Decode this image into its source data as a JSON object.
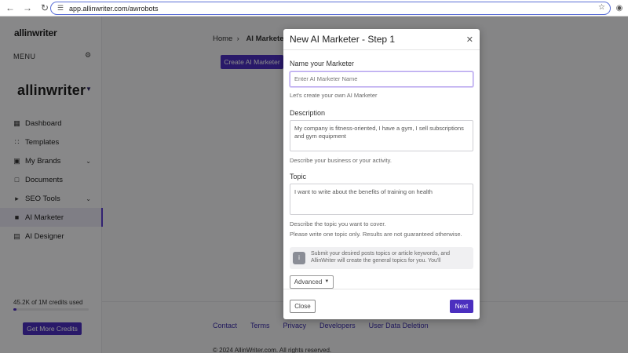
{
  "browser": {
    "url": "app.allinwriter.com/awrobots"
  },
  "sidebar": {
    "logo_small": "allinwriter",
    "menu_label": "MENU",
    "logo_big": "allinwriter",
    "items": [
      {
        "label": "Dashboard",
        "icon": "dashboard-icon"
      },
      {
        "label": "Templates",
        "icon": "grid-icon"
      },
      {
        "label": "My Brands",
        "icon": "briefcase-icon"
      },
      {
        "label": "Documents",
        "icon": "document-icon"
      },
      {
        "label": "SEO Tools",
        "icon": "megaphone-icon"
      },
      {
        "label": "AI Marketer",
        "icon": "robot-icon"
      },
      {
        "label": "AI Designer",
        "icon": "image-icon"
      }
    ],
    "credits_text": "45.2K of 1M credits used",
    "credits_fraction": 0.045,
    "more_credits": "Get More Credits"
  },
  "main": {
    "breadcrumb_home": "Home",
    "breadcrumb_current": "AI Marketer",
    "create_button": "Create AI Marketer",
    "footer_links": [
      "Contact",
      "Terms",
      "Privacy",
      "Developers",
      "User Data Deletion"
    ],
    "copyright": "© 2024 AllinWriter.com. All rights reserved."
  },
  "modal": {
    "title": "New AI Marketer - Step 1",
    "name_label": "Name your Marketer",
    "name_placeholder": "Enter AI Marketer Name",
    "name_hint": "Let's create your own AI Marketer",
    "description_label": "Description",
    "description_value": "My company is fitness-oriented, I have a gym, I sell subscriptions and gym equipment",
    "description_hint": "Describe your business or your activity.",
    "topic_label": "Topic",
    "topic_value": "I want to write about the benefits of training on health",
    "topic_hint1": "Describe the topic you want to cover.",
    "topic_hint2": "Please write one topic only. Results are not guaranteed otherwise.",
    "info_text": "Submit your desired posts topics or article keywords, and AllinWriter will create the general topics for you. You'll",
    "advanced": "Advanced",
    "close_button": "Close",
    "next_button": "Next"
  },
  "colors": {
    "accent": "#4b2fbf",
    "overlay": "rgba(0,0,0,0.45)"
  }
}
